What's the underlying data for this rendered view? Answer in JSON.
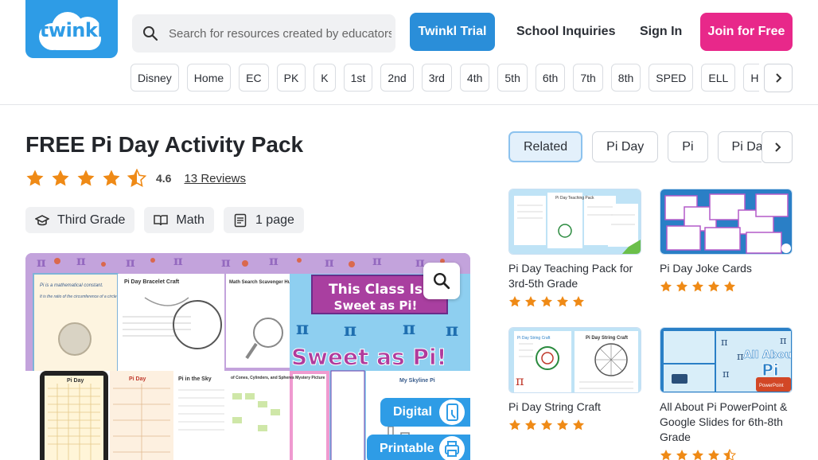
{
  "logo": {
    "text": "twinkl"
  },
  "search": {
    "placeholder": "Search for resources created by educators"
  },
  "header": {
    "trial_label": "Twinkl Trial",
    "school_label": "School Inquiries",
    "signin_label": "Sign In",
    "join_label": "Join for Free"
  },
  "grades": [
    "Disney",
    "Home",
    "EC",
    "PK",
    "K",
    "1st",
    "2nd",
    "3rd",
    "4th",
    "5th",
    "6th",
    "7th",
    "8th",
    "SPED",
    "ELL",
    "Homeschool"
  ],
  "product": {
    "title": "FREE Pi Day Activity Pack",
    "rating": 4.6,
    "rating_label": "4.6",
    "reviews_label": "13 Reviews",
    "tags": [
      {
        "icon": "grade-cap-icon",
        "label": "Third Grade"
      },
      {
        "icon": "book-icon",
        "label": "Math"
      },
      {
        "icon": "page-icon",
        "label": "1 page"
      }
    ],
    "preview_badges": {
      "digital": "Digital",
      "printable": "Printable"
    },
    "preview_text": {
      "pi_fact_title": "Pi is a mathematical constant.",
      "pi_fact_body": "It is the ratio of the circumference of a circle to its diameter.",
      "bracelet": "Pi Day Bracelet Craft",
      "scavenger": "Math Search Scavenger Hunt",
      "class_is": "This Class Is",
      "sweet": "Sweet as Pi!",
      "sweet_big": "Sweet as Pi!",
      "pi_day": "Pi Day",
      "pi_sky": "Pi in the Sky",
      "cones": "of Cones, Cylinders, and Spheres Mystery Picture",
      "skyline": "My Skyline Pi"
    }
  },
  "related": {
    "tabs": [
      "Related",
      "Pi Day",
      "Pi",
      "Pi Day Activities"
    ],
    "active_tab": 0,
    "cards": [
      {
        "title": "Pi Day Teaching Pack for 3rd-5th Grade",
        "rating": 5,
        "thumb_caption": ""
      },
      {
        "title": "Pi Day Joke Cards",
        "rating": 5,
        "thumb_caption": ""
      },
      {
        "title": "Pi Day String Craft",
        "rating": 5,
        "thumb_caption": "Pi Day String Craft"
      },
      {
        "title": "All About Pi PowerPoint & Google Slides for 6th-8th Grade",
        "rating": 4.5,
        "thumb_caption": "All About Pi"
      }
    ],
    "thumb_text": {
      "teaching_pack": "Pi Day Teaching Pack",
      "string_craft_small": "Pi Day String Craft",
      "string_craft_big": "Pi Day String Craft",
      "all_about": "All About",
      "pi": "Pi",
      "powerpoint": "PowerPoint"
    }
  },
  "colors": {
    "brand_blue": "#2e9ce6",
    "trial_blue": "#2a8ed9",
    "join_pink": "#e8288a",
    "star_orange": "#ef8a16"
  }
}
